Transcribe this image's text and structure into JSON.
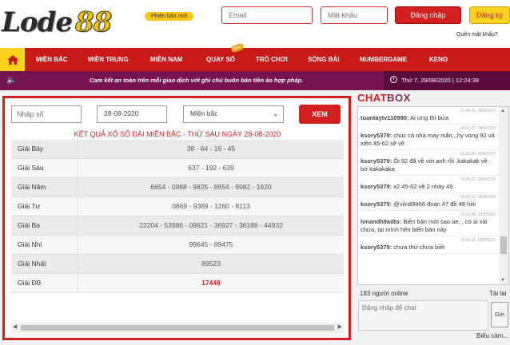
{
  "header": {
    "logo_text": "Lode",
    "logo_num": "88",
    "version_badge": "Phiên bản mới",
    "email_placeholder": "Email",
    "password_placeholder": "Mật khẩu",
    "login_label": "Đăng nhập",
    "register_label": "Đăng ký",
    "forgot_label": "Quên mật khẩu?"
  },
  "nav": {
    "home_icon": "home-icon",
    "items": [
      "MIỀN BẮC",
      "MIỀN TRUNG",
      "MIỀN NAM",
      "QUAY SỐ",
      "TRÒ CHƠI",
      "SÒNG BÀI",
      "NUMBERGAME",
      "KENO"
    ],
    "new_tag": "New"
  },
  "infobar": {
    "marquee": "Cam kết an toàn trên mỗi giao dịch với ghi chú buôn bán tiền ảo hợp pháp.",
    "datetime": "Thứ 7, 29/08/2020 | 12:24:39"
  },
  "filter": {
    "number_placeholder": "Nhập số",
    "date_value": "28-08-2020",
    "region_value": "Miền bắc",
    "submit_label": "XEM"
  },
  "result": {
    "title": "KẾT QUẢ XỔ SỐ ĐÀI MIỀN BẮC - THỨ SÁU NGÀY 28-08-2020",
    "rows": [
      {
        "label": "Giải Bảy",
        "value": "38 - 64 - 16 - 45"
      },
      {
        "label": "Giải Sáu",
        "value": "637 - 192 - 639"
      },
      {
        "label": "Giải Năm",
        "value": "6654 - 0988 - 9825 - 8654 - 9982 - 1620"
      },
      {
        "label": "Giải Tư",
        "value": "0869 - 9369 - 1260 - 8113"
      },
      {
        "label": "Giải Ba",
        "value": "22204 - 53986 - 09621 - 36927 - 36188 - 44932"
      },
      {
        "label": "Giải Nhì",
        "value": "99645 - 89475"
      },
      {
        "label": "Giải Nhất",
        "value": "89523"
      },
      {
        "label": "Giải ĐB",
        "value": "17448"
      }
    ]
  },
  "chat": {
    "title_a": "CHAT",
    "title_b": "BOX",
    "messages": [
      {
        "time": "17:48:35, 28/8/2020",
        "user": "tuantaytv110990:",
        "text": "Ai ưng thì bửa"
      },
      {
        "time": "18:01:07, 28/8/2020",
        "user": "ksory5379:",
        "text": "chúc cả nhà may mắn,,,hy vong 92 và xiên 45-62 sẽ về"
      },
      {
        "time": "18:23:38, 28/8/2020",
        "user": "ksory5379:",
        "text": "Ồi 92 đã về với anh rồi ,kakakak về bờ kakakaka"
      },
      {
        "time": "18:25:22, 28/8/2020",
        "user": "ksory5379:",
        "text": "x2 45-62 về 2 nháy 45"
      },
      {
        "time": "18:31:03, 28/8/2020",
        "user": "ksory5379:",
        "text": "@viln89466 đoán 47 đề 48 hiiii"
      },
      {
        "time": "18:52:48, 28/8/2020",
        "user": "lvnandh9adto:",
        "text": "Biển bản mới sao ae, , có ai xài chưa, tại mình hên biển bản này"
      },
      {
        "time": "18:54:11, 28/8/2020",
        "user": "ksory5379:",
        "text": "chưa thử chưa biết"
      }
    ],
    "online": "183 người online",
    "reload": "Tải lại",
    "input_placeholder": "Đăng nhập để chat",
    "send_label": "Gửi",
    "emoticon_label": "Biểu cảm..."
  }
}
